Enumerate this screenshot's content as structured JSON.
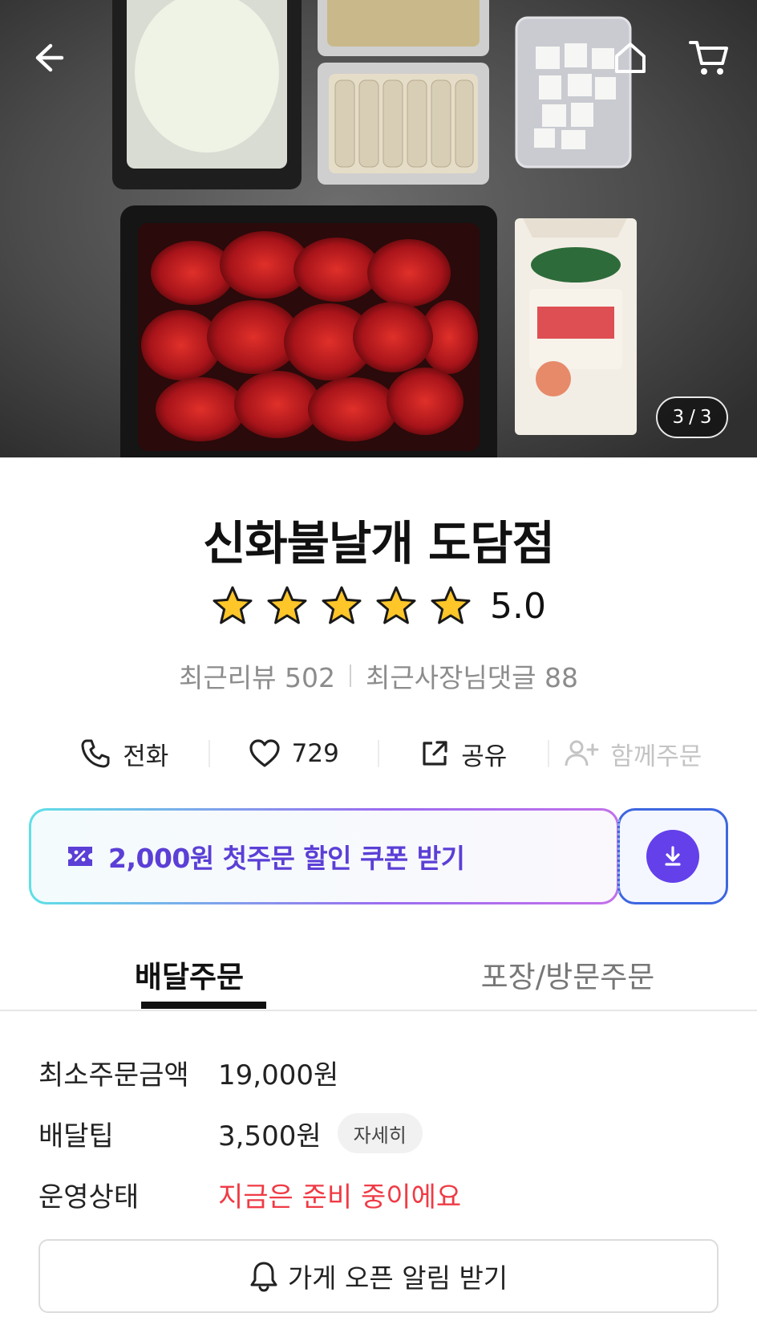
{
  "hero": {
    "page_current": "3",
    "page_separator": "/",
    "page_total": "3",
    "icons": {
      "back": "arrow-left-icon",
      "home": "home-icon",
      "cart": "cart-icon"
    }
  },
  "store": {
    "name": "신화불날개 도담점",
    "rating": "5.0",
    "stars_filled": 5,
    "recent_reviews": "최근리뷰 502",
    "owner_replies": "최근사장님댓글 88"
  },
  "actions": {
    "call": "전화",
    "likes": "729",
    "share": "공유",
    "group_order": "함께주문"
  },
  "coupon": {
    "text": "2,000원 첫주문 할인 쿠폰 받기",
    "colors": {
      "text": "#5b3fd6",
      "download_bg": "#6340ea"
    }
  },
  "tabs": {
    "delivery": "배달주문",
    "pickup": "포장/방문주문"
  },
  "info": {
    "min_order_label": "최소주문금액",
    "min_order_value": "19,000원",
    "delivery_tip_label": "배달팁",
    "delivery_tip_value": "3,500원",
    "delivery_tip_detail": "자세히",
    "status_label": "운영상태",
    "status_value": "지금은 준비 중이에요",
    "status_color": "#ef3b45"
  },
  "notify": {
    "label": "가게 오픈 알림 받기"
  }
}
